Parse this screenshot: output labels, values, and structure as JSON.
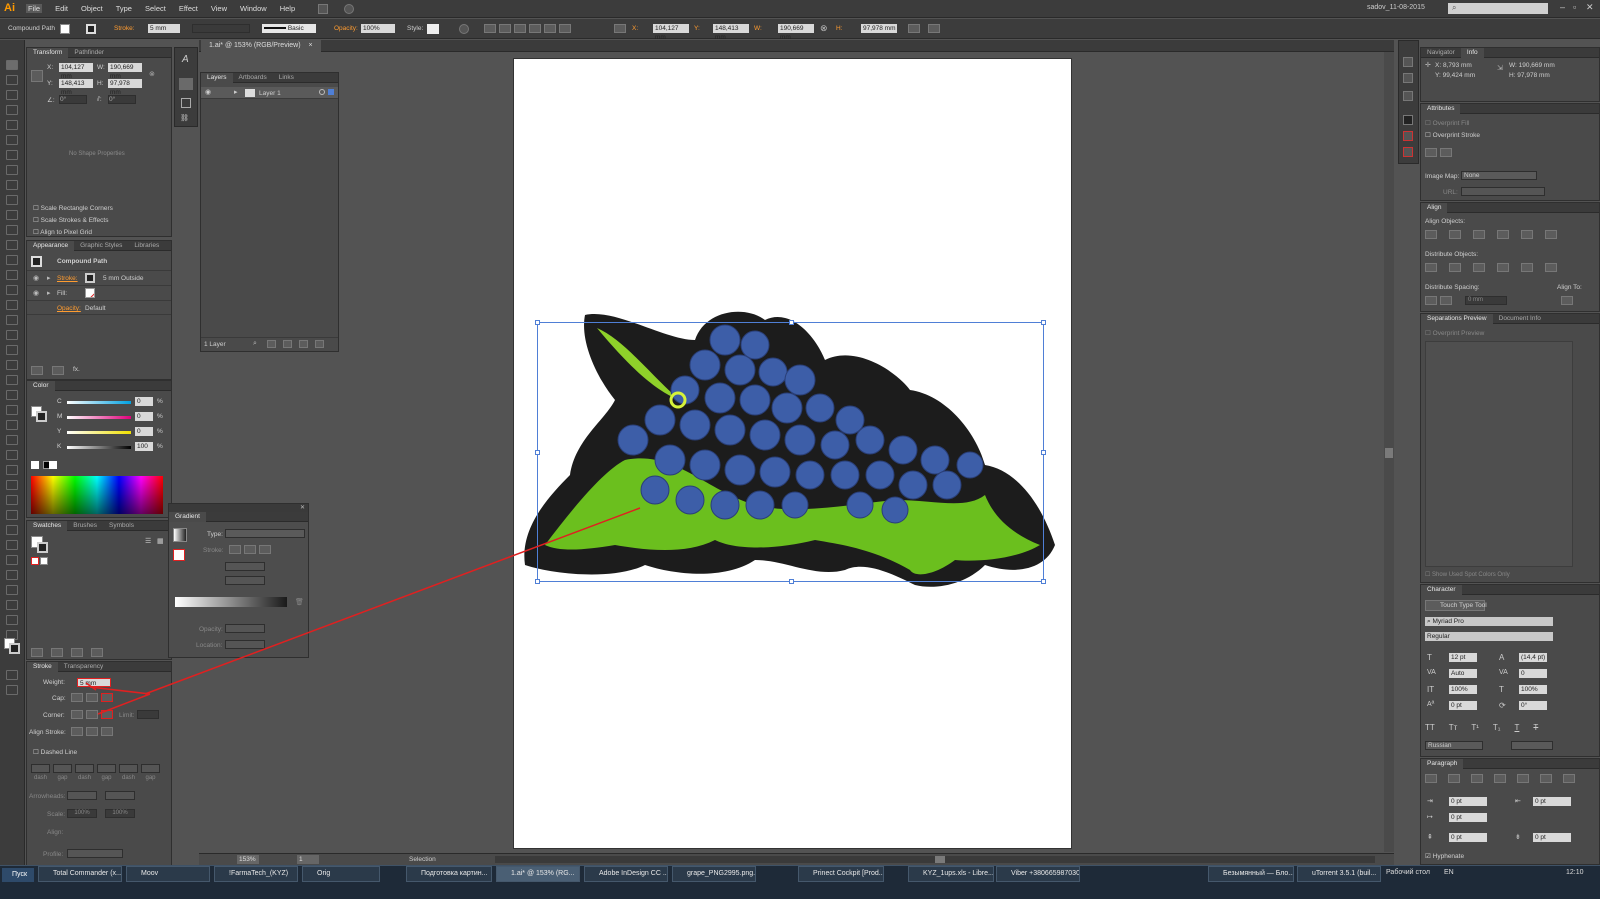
{
  "app": {
    "logo": "Ai",
    "user": "sadov_11-08-2015",
    "menu": [
      "File",
      "Edit",
      "Object",
      "Type",
      "Select",
      "Effect",
      "View",
      "Window",
      "Help"
    ]
  },
  "control": {
    "selection_type": "Compound Path",
    "stroke_label": "Stroke:",
    "stroke_value": "5 mm",
    "brush": "Basic",
    "opacity_label": "Opacity:",
    "opacity_value": "100%",
    "style_label": "Style:",
    "x_label": "X:",
    "x_value": "104,127 mm",
    "y_label": "Y:",
    "y_value": "148,413 mm",
    "w_label": "W:",
    "w_value": "190,669 mm",
    "h_label": "H:",
    "h_value": "97,978 mm"
  },
  "doc_tab": {
    "title": "1.ai* @ 153% (RGB/Preview)",
    "close": "×"
  },
  "transform": {
    "tab1": "Transform",
    "tab2": "Pathfinder",
    "x": "104,127 mm",
    "y": "148,413 mm",
    "w": "190,669 mm",
    "h": "97,978 mm",
    "angle": "0°",
    "shear": "0°",
    "no_shape": "No Shape Properties",
    "chk1": "Scale Rectangle Corners",
    "chk2": "Scale Strokes & Effects",
    "chk3": "Align to Pixel Grid"
  },
  "appearance": {
    "tab1": "Appearance",
    "tab2": "Graphic Styles",
    "tab3": "Libraries",
    "title": "Compound Path",
    "stroke_label": "Stroke:",
    "stroke_value": "5 mm  Outside",
    "fill_label": "Fill:",
    "opacity_label": "Opacity:",
    "opacity_value": "Default"
  },
  "color": {
    "tab": "Color",
    "c": "0",
    "m": "0",
    "y": "0",
    "k": "100",
    "pct": "%",
    "c_l": "C",
    "m_l": "M",
    "y_l": "Y",
    "k_l": "K"
  },
  "swatches": {
    "tab1": "Swatches",
    "tab2": "Brushes",
    "tab3": "Symbols"
  },
  "stroke": {
    "tab1": "Stroke",
    "tab2": "Transparency",
    "weight_label": "Weight:",
    "weight": "5 mm",
    "cap_label": "Cap:",
    "corner_label": "Corner:",
    "limit_label": "Limit:",
    "align_label": "Align Stroke:",
    "dashed": "Dashed Line",
    "dash": [
      "dash",
      "gap",
      "dash",
      "gap",
      "dash",
      "gap"
    ],
    "arrowheads": "Arrowheads:",
    "scale": "Scale:",
    "scale1": "100%",
    "scale2": "100%",
    "align2": "Align:",
    "profile": "Profile:"
  },
  "layers": {
    "tab1": "Layers",
    "tab2": "Artboards",
    "tab3": "Links",
    "layer": "Layer 1",
    "count": "1 Layer"
  },
  "gradient": {
    "tab": "Gradient",
    "type_label": "Type:",
    "stroke_label": "Stroke:",
    "opacity_label": "Opacity:",
    "location_label": "Location:"
  },
  "navigator": {
    "tab1": "Navigator",
    "tab2": "Info",
    "x": "X: 8,793 mm",
    "y": "Y: 99,424 mm",
    "w": "W: 190,669 mm",
    "h": "H: 97,978 mm"
  },
  "attributes": {
    "tab": "Attributes",
    "overprint_fill": "Overprint Fill",
    "overprint_stroke": "Overprint Stroke",
    "image_map": "Image Map:",
    "image_map_value": "None",
    "url": "URL:"
  },
  "align": {
    "tab": "Align",
    "align_objects": "Align Objects:",
    "distribute_objects": "Distribute Objects:",
    "distribute_spacing": "Distribute Spacing:",
    "spacing_value": "0 mm",
    "align_to": "Align To:"
  },
  "separations": {
    "tab1": "Separations Preview",
    "tab2": "Document Info",
    "overprint_preview": "Overprint Preview",
    "spot": "Show Used Spot Colors Only"
  },
  "character": {
    "tab": "Character",
    "touch_type": "Touch Type Tool",
    "font": "Myriad Pro",
    "style": "Regular",
    "size": "12 pt",
    "leading": "(14,4 pt)",
    "kerning": "Auto",
    "tracking": "0",
    "vscale": "100%",
    "hscale": "100%",
    "baseline": "0 pt",
    "rotate": "0°",
    "language": "Russian"
  },
  "paragraph": {
    "tab": "Paragraph",
    "left": "0 pt",
    "right": "0 pt",
    "first": "0 pt",
    "before": "0 pt",
    "after": "0 pt",
    "hyphenate": "Hyphenate"
  },
  "status": {
    "zoom": "153%",
    "page": "1",
    "tool": "Selection"
  },
  "taskbar": {
    "start": "Пуск",
    "items": [
      "Total Commander (x...",
      "Moov",
      "!FarmaTech_(KYZ)",
      "Orig",
      "Подготовка картин...",
      "1.ai* @ 153% (RG...",
      "Adobe InDesign CC ...",
      "grape_PNG2995.png...",
      "Prinect Cockpit [Prod...",
      "KYZ_1ups.xls - Libre...",
      "Viber +380665987030",
      "uTorrent 3.5.1 (buil...",
      "Безымянный — Бло..."
    ],
    "desktop": "Рабочий стол",
    "lang": "EN",
    "time": "12:10"
  },
  "colors": {
    "bg": "#535353",
    "panel": "#4a4a4a",
    "accent_red": "#e02020",
    "selection": "#4f7fd6"
  }
}
